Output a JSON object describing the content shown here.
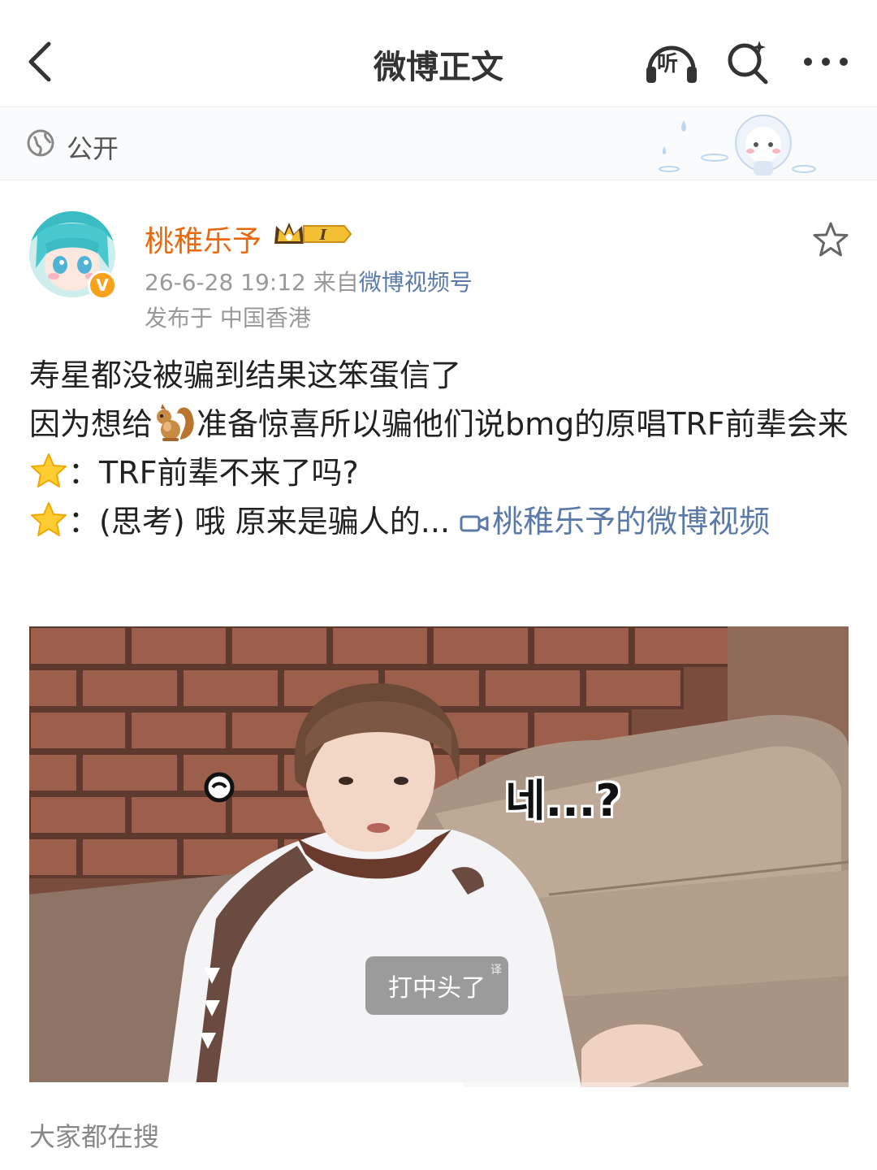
{
  "header": {
    "title": "微博正文",
    "listen_label": "听"
  },
  "visibility": {
    "label": "公开"
  },
  "post": {
    "author": {
      "name": "桃稚乐予",
      "badge_level": "I",
      "verified_mark": "V"
    },
    "time": "26-6-28 19:12",
    "source_prefix": "来自",
    "source": "微博视频号",
    "location": "发布于 中国香港",
    "text": {
      "line1": "寿星都没被骗到结果这笨蛋信了",
      "line2_before_emoji": "因为想给",
      "line2_after_emoji": "准备惊喜所以骗他们说bmg的原唱TRF前辈会来",
      "line3": "：TRF前辈不来了吗?",
      "line4": "：(思考) 哦 原来是骗人的...",
      "video_link": "桃稚乐予的微博视频"
    },
    "video": {
      "subtitle": "打中头了",
      "translate_mark": "译",
      "overlay_korean": "네...?",
      "progress": 0.53
    }
  },
  "trending": {
    "title": "大家都在搜"
  },
  "colors": {
    "author_name": "#e8680e",
    "link": "#5b7aa8",
    "meta": "#999999",
    "verified": "#f7a21a"
  }
}
